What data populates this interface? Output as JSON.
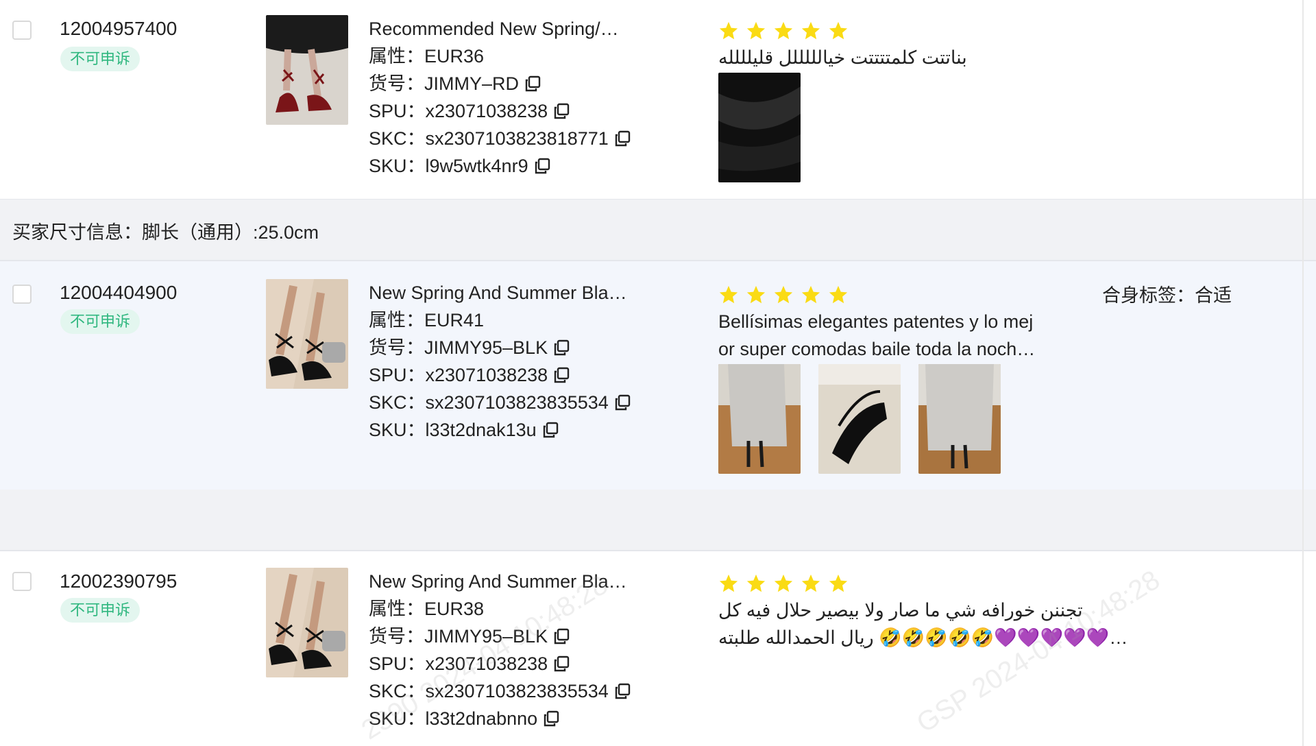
{
  "rows": [
    {
      "order_id": "12004957400",
      "tag": "不可申诉",
      "title": "Recommended New Spring/…",
      "attr": "属性：EUR36",
      "item_no": "货号：JIMMY–RD",
      "spu": "SPU：x23071038238",
      "skc": "SKC：sx2307103823818771",
      "sku": "SKU：l9w5wtk4nr9",
      "rating": 5,
      "review_lines": [
        "بناتتت كلمتتتتت خيالللللل قليلللله"
      ],
      "fit": ""
    },
    {
      "order_id": "12004404900",
      "tag": "不可申诉",
      "title": "New Spring And Summer Bla…",
      "attr": "属性：EUR41",
      "item_no": "货号：JIMMY95–BLK",
      "spu": "SPU：x23071038238",
      "skc": "SKC：sx2307103823835534",
      "sku": "SKU：l33t2dnak13u",
      "rating": 5,
      "review_lines": [
        "Bellísimas elegantes patentes y lo mej",
        "or super comodas baile toda la noch…"
      ],
      "fit": "合身标签：合适"
    },
    {
      "order_id": "12002390795",
      "tag": "不可申诉",
      "title": "New Spring And Summer Bla…",
      "attr": "属性：EUR38",
      "item_no": "货号：JIMMY95–BLK",
      "spu": "SPU：x23071038238",
      "skc": "SKC：sx2307103823835534",
      "sku": "SKU：l33t2dnabnno",
      "rating": 5,
      "review_lines": [
        "تجننن خورافه شي ما صار ولا بيصير حلال فيه كل",
        "ريال الحمدالله طلبته 🤣🤣🤣🤣🤣💜💜💜💜💜…"
      ],
      "fit": ""
    }
  ],
  "buyer_size_info": "买家尺寸信息：脚长（通用）:25.0cm",
  "icons": {
    "copy": "copy-icon",
    "star": "star-icon",
    "star_color": "#fadb14",
    "tag_color": "#2fb77f"
  }
}
